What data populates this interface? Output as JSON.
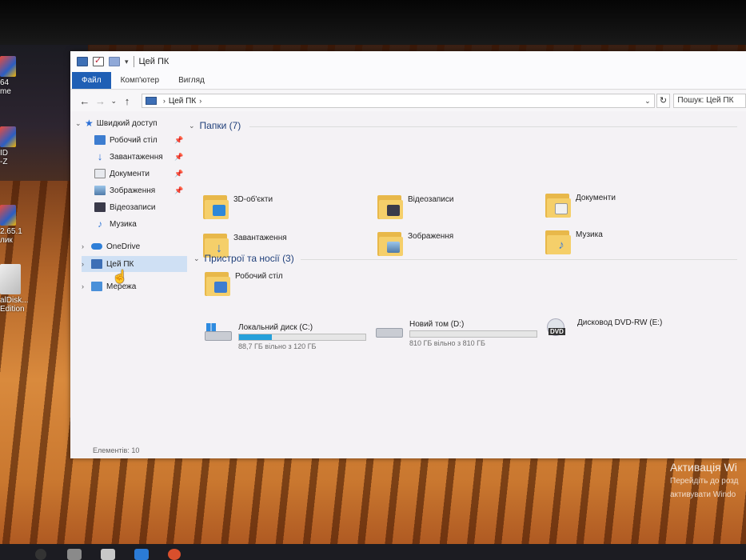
{
  "window": {
    "title": "Цей ПК",
    "ribbon_tabs": [
      "Файл",
      "Комп'ютер",
      "Вигляд"
    ],
    "address_path": "Цей ПК",
    "search_placeholder": "Пошук: Цей ПК"
  },
  "sidebar": {
    "quick_access": "Швидкий доступ",
    "items": [
      {
        "label": "Робочий стіл",
        "pinned": true,
        "icon": "desktop-icon"
      },
      {
        "label": "Завантаження",
        "pinned": true,
        "icon": "download-icon"
      },
      {
        "label": "Документи",
        "pinned": true,
        "icon": "documents-icon"
      },
      {
        "label": "Зображення",
        "pinned": true,
        "icon": "pictures-icon"
      },
      {
        "label": "Відеозаписи",
        "pinned": false,
        "icon": "videos-icon"
      },
      {
        "label": "Музика",
        "pinned": false,
        "icon": "music-icon"
      }
    ],
    "onedrive": "OneDrive",
    "this_pc": "Цей ПК",
    "network": "Мережа"
  },
  "content": {
    "folders_header": "Папки (7)",
    "folders": [
      {
        "label": "3D-об'єкти",
        "icon": "3d-objects-icon"
      },
      {
        "label": "Відеозаписи",
        "icon": "videos-icon"
      },
      {
        "label": "Документи",
        "icon": "documents-icon"
      },
      {
        "label": "Завантаження",
        "icon": "download-icon"
      },
      {
        "label": "Зображення",
        "icon": "pictures-icon"
      },
      {
        "label": "Музика",
        "icon": "music-icon"
      },
      {
        "label": "Робочий стіл",
        "icon": "desktop-icon"
      }
    ],
    "devices_header": "Пристрої та носії (3)",
    "drives": [
      {
        "name": "Локальний диск (C:)",
        "free": "88,7 ГБ вільно з 120 ГБ",
        "used_fraction": 0.26
      },
      {
        "name": "Новий том (D:)",
        "free": "810 ГБ вільно з 810 ГБ",
        "used_fraction": 0.0
      },
      {
        "name": "Дисковод DVD-RW (E:)"
      }
    ]
  },
  "status": {
    "items": "Елементів: 10"
  },
  "desktop": {
    "icon_labels": [
      "64",
      "me",
      "ID",
      "-Z",
      "2.65.1",
      "лик",
      "alDisk...",
      "Edition"
    ],
    "activation_title": "Активація Wi",
    "activation_line1": "Перейдіть до розд",
    "activation_line2": "активувати Windo"
  },
  "colors": {
    "accent": "#1f5fb5",
    "drive_fill": "#26a0da",
    "folder": "#f5cf6a"
  }
}
